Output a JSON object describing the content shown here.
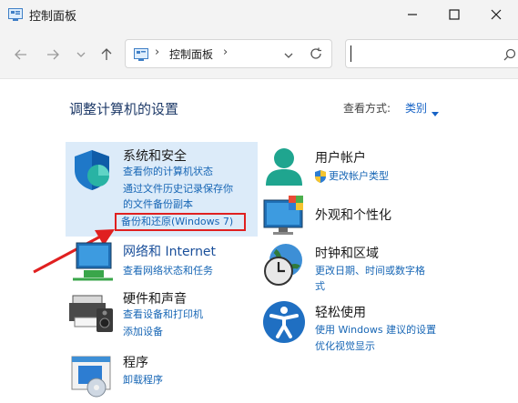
{
  "window": {
    "title": "控制面板",
    "controls": [
      "minimize",
      "maximize",
      "close"
    ]
  },
  "address_bar": {
    "path": "控制面板",
    "separator": "›",
    "search_value": ""
  },
  "page": {
    "heading": "调整计算机的设置",
    "view_by_label": "查看方式:",
    "view_by_value": "类别"
  },
  "categories": {
    "system_security": {
      "title": "系统和安全",
      "links": [
        "查看你的计算机状态",
        "通过文件历史记录保存你",
        "的文件备份副本",
        "备份和还原(Windows 7)"
      ]
    },
    "user_accounts": {
      "title": "用户帐户",
      "links": [
        "更改帐户类型"
      ]
    },
    "appearance": {
      "title": "外观和个性化"
    },
    "network": {
      "title": "网络和 Internet",
      "links": [
        "查看网络状态和任务"
      ]
    },
    "clock_region": {
      "title": "时钟和区域",
      "links": [
        "更改日期、时间或数字格",
        "式"
      ]
    },
    "hardware_sound": {
      "title": "硬件和声音",
      "links": [
        "查看设备和打印机",
        "添加设备"
      ]
    },
    "ease_access": {
      "title": "轻松使用",
      "links": [
        "使用 Windows 建议的设置",
        "优化视觉显示"
      ]
    },
    "programs": {
      "title": "程序",
      "links": [
        "卸载程序"
      ]
    }
  },
  "colors": {
    "titlebar_bg": "#f3f3f3",
    "highlight_bg": "#dcebf9",
    "link": "#1766b5",
    "heading": "#1e3a68",
    "annotation_red": "#e02020"
  }
}
